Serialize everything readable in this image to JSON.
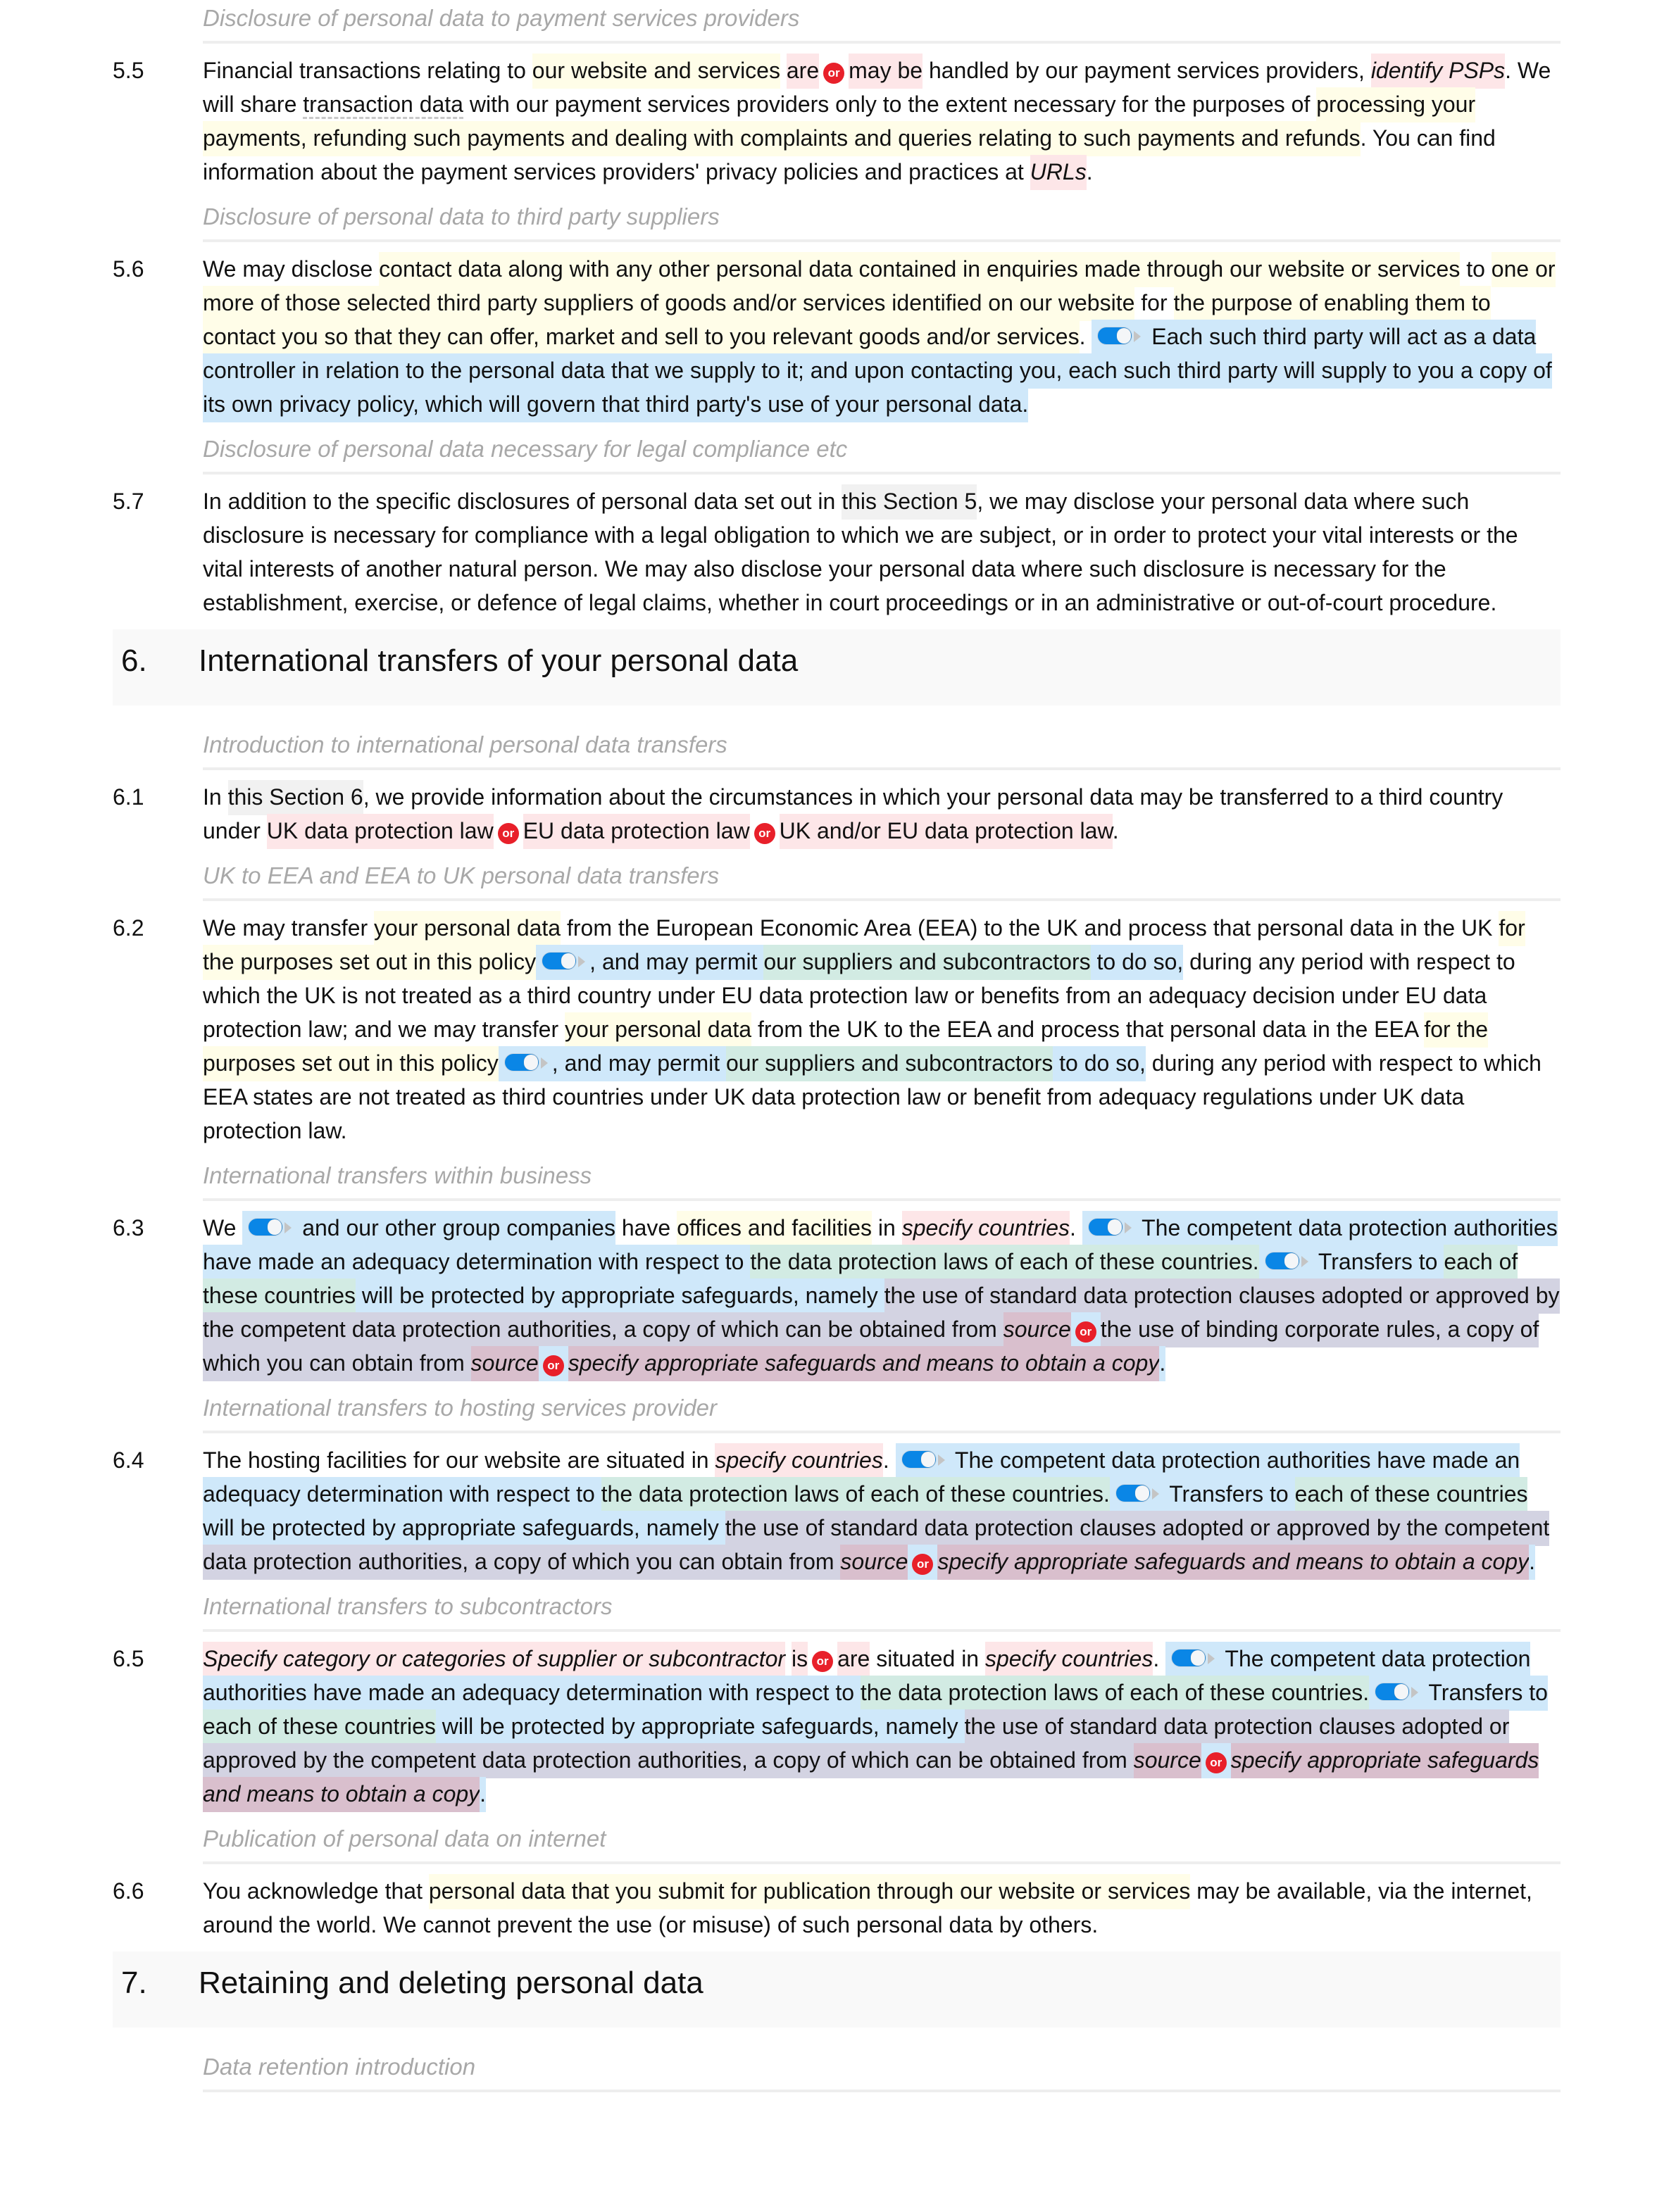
{
  "document": {
    "blocks": [
      {
        "type": "subheading",
        "text": "Disclosure of personal data to payment services providers"
      },
      {
        "type": "clause",
        "number": "5.5",
        "segments": [
          {
            "t": "Financial transactions relating to "
          },
          {
            "t": "our website and services",
            "hl": "y"
          },
          {
            "t": " "
          },
          {
            "t": "are",
            "hl": "p"
          },
          {
            "or": true
          },
          {
            "t": "may be",
            "hl": "p"
          },
          {
            "t": " handled by our payment services providers, "
          },
          {
            "t": "identify PSPs",
            "hl": "p",
            "italic": true
          },
          {
            "t": ". We will share "
          },
          {
            "t": "transaction data",
            "underline": true
          },
          {
            "t": " with our payment services providers only to the extent necessary for the purposes of "
          },
          {
            "t": "processing your payments, refunding such payments and dealing with complaints and queries relating to such payments and refunds",
            "hl": "y"
          },
          {
            "t": ". You can find information about the payment services providers' privacy policies and practices at "
          },
          {
            "t": "URLs",
            "hl": "p",
            "italic": true
          },
          {
            "t": "."
          }
        ]
      },
      {
        "type": "subheading",
        "text": "Disclosure of personal data to third party suppliers"
      },
      {
        "type": "clause",
        "number": "5.6",
        "segments": [
          {
            "t": "We may disclose "
          },
          {
            "t": "contact data",
            "hl": "y",
            "underline": true
          },
          {
            "t": " along with any other personal data contained in enquiries made through our website or services",
            "hl": "y"
          },
          {
            "t": " to "
          },
          {
            "t": "one or more of those selected third party suppliers of goods and/or services identified on our website",
            "hl": "y"
          },
          {
            "t": " for "
          },
          {
            "t": "the purpose of enabling them to contact you so that they can offer, market and sell to you relevant goods and/or services",
            "hl": "y"
          },
          {
            "t": ". "
          },
          {
            "toggle": true,
            "hl": "b"
          },
          {
            "t": " Each such third party will act as a data controller in relation to the personal data that we supply to it; and upon contacting you, each such third party will supply to you a copy of its own privacy policy, which will govern that third party's use of your personal data.",
            "hl": "b"
          }
        ]
      },
      {
        "type": "subheading",
        "text": "Disclosure of personal data necessary for legal compliance etc"
      },
      {
        "type": "clause",
        "number": "5.7",
        "segments": [
          {
            "t": "In addition to the specific disclosures of personal data set out in "
          },
          {
            "t": "this Section 5",
            "hl": "s"
          },
          {
            "t": ", we may disclose your personal data where such disclosure is necessary for compliance with a legal obligation to which we are subject, or in order to protect your vital interests or the vital interests of another natural person. We may also disclose your personal data where such disclosure is necessary for the establishment, exercise, or defence of legal claims, whether in court proceedings or in an administrative or out-of-court procedure."
          }
        ]
      },
      {
        "type": "section",
        "number": "6.",
        "title": "International transfers of your personal data"
      },
      {
        "type": "subheading",
        "text": "Introduction to international personal data transfers"
      },
      {
        "type": "clause",
        "number": "6.1",
        "segments": [
          {
            "t": "In "
          },
          {
            "t": "this Section 6",
            "hl": "s"
          },
          {
            "t": ", we provide information about the circumstances in which your personal data may be transferred to a third country under "
          },
          {
            "t": "UK data protection law",
            "hl": "p"
          },
          {
            "or": true
          },
          {
            "t": "EU data protection law",
            "hl": "p"
          },
          {
            "or": true
          },
          {
            "t": "UK and/or EU data protection law",
            "hl": "p"
          },
          {
            "t": "."
          }
        ]
      },
      {
        "type": "subheading",
        "text": "UK to EEA and EEA to UK personal data transfers"
      },
      {
        "type": "clause",
        "number": "6.2",
        "segments": [
          {
            "t": "We may transfer "
          },
          {
            "t": "your personal data",
            "hl": "y"
          },
          {
            "t": " from the European Economic Area (EEA) to the UK and process that personal data in the UK "
          },
          {
            "t": "for the purposes set out in this policy",
            "hl": "y"
          },
          {
            "toggle": true,
            "hl": "b"
          },
          {
            "t": ", and may permit ",
            "hl": "b"
          },
          {
            "t": "our suppliers and subcontractors",
            "hl": "g"
          },
          {
            "t": " to do so,",
            "hl": "b"
          },
          {
            "t": " during any period with respect to which the UK is not treated as a third country under EU data protection law or benefits from an adequacy decision under EU data protection law; and we may transfer "
          },
          {
            "t": "your personal data",
            "hl": "y"
          },
          {
            "t": " from the UK to the EEA and process that personal data in the EEA "
          },
          {
            "t": "for the purposes set out in this policy",
            "hl": "y"
          },
          {
            "toggle": true,
            "hl": "b"
          },
          {
            "t": ", and may permit ",
            "hl": "b"
          },
          {
            "t": "our suppliers and subcontractors",
            "hl": "g"
          },
          {
            "t": " to do so,",
            "hl": "b"
          },
          {
            "t": " during any period with respect to which EEA states are not treated as third countries under UK data protection law or benefit from adequacy regulations under UK data protection law."
          }
        ]
      },
      {
        "type": "subheading",
        "text": "International transfers within business"
      },
      {
        "type": "clause",
        "number": "6.3",
        "segments": [
          {
            "t": "We "
          },
          {
            "toggle": true,
            "hl": "b"
          },
          {
            "t": " and our other group companies",
            "hl": "b"
          },
          {
            "t": " have "
          },
          {
            "t": "offices and facilities",
            "hl": "y"
          },
          {
            "t": " in "
          },
          {
            "t": "specify countries",
            "hl": "p",
            "italic": true
          },
          {
            "t": ". "
          },
          {
            "toggle": true,
            "hl": "b"
          },
          {
            "t": " The competent data protection authorities have made an adequacy determination with respect to ",
            "hl": "b"
          },
          {
            "t": "the data protection laws of each of these countries.",
            "hl": "g"
          },
          {
            "toggle": true,
            "hl": "b"
          },
          {
            "t": " Transfers to ",
            "hl": "b"
          },
          {
            "t": "each of these countries",
            "hl": "g"
          },
          {
            "t": " will be protected by appropriate safeguards, namely ",
            "hl": "b"
          },
          {
            "t": "the use of standard data protection clauses adopted or approved by the competent data protection authorities, a copy of which can be obtained from ",
            "hl": "v"
          },
          {
            "t": "source",
            "hl": "m",
            "italic": true
          },
          {
            "or": true,
            "hl": "b"
          },
          {
            "t": "the use of binding corporate rules, a copy of which you can obtain from ",
            "hl": "v"
          },
          {
            "t": "source",
            "hl": "m",
            "italic": true
          },
          {
            "or": true,
            "hl": "b"
          },
          {
            "t": "specify appropriate safeguards and means to obtain a copy",
            "hl": "m",
            "italic": true
          },
          {
            "t": ".",
            "hl": "b"
          }
        ]
      },
      {
        "type": "subheading",
        "text": "International transfers to hosting services provider"
      },
      {
        "type": "clause",
        "number": "6.4",
        "segments": [
          {
            "t": "The hosting facilities for our website are situated in "
          },
          {
            "t": "specify countries",
            "hl": "p",
            "italic": true
          },
          {
            "t": ". "
          },
          {
            "toggle": true,
            "hl": "b"
          },
          {
            "t": " The competent data protection authorities have made an adequacy determination with respect to ",
            "hl": "b"
          },
          {
            "t": "the data protection laws of each of these countries.",
            "hl": "g"
          },
          {
            "toggle": true,
            "hl": "b"
          },
          {
            "t": " Transfers to ",
            "hl": "b"
          },
          {
            "t": "each of these countries",
            "hl": "g"
          },
          {
            "t": " will be protected by appropriate safeguards, namely ",
            "hl": "b"
          },
          {
            "t": "the use of standard data protection clauses adopted or approved by the competent data protection authorities, a copy of which you can obtain from ",
            "hl": "v"
          },
          {
            "t": "source",
            "hl": "m",
            "italic": true
          },
          {
            "or": true,
            "hl": "b"
          },
          {
            "t": "specify appropriate safeguards and means to obtain a copy",
            "hl": "m",
            "italic": true
          },
          {
            "t": ".",
            "hl": "b"
          }
        ]
      },
      {
        "type": "subheading",
        "text": "International transfers to subcontractors"
      },
      {
        "type": "clause",
        "number": "6.5",
        "segments": [
          {
            "t": "Specify category or categories of supplier or subcontractor",
            "hl": "p",
            "italic": true
          },
          {
            "t": " "
          },
          {
            "t": "is",
            "hl": "p"
          },
          {
            "or": true
          },
          {
            "t": "are",
            "hl": "p"
          },
          {
            "t": " situated in "
          },
          {
            "t": "specify countries",
            "hl": "p",
            "italic": true
          },
          {
            "t": ". "
          },
          {
            "toggle": true,
            "hl": "b"
          },
          {
            "t": " The competent data protection authorities have made an adequacy determination with respect to ",
            "hl": "b"
          },
          {
            "t": "the data protection laws of each of these countries.",
            "hl": "g"
          },
          {
            "toggle": true,
            "hl": "b"
          },
          {
            "t": " Transfers to ",
            "hl": "b"
          },
          {
            "t": "each of these countries",
            "hl": "g"
          },
          {
            "t": " will be protected by appropriate safeguards, namely ",
            "hl": "b"
          },
          {
            "t": "the use of standard data protection clauses adopted or approved by the competent data protection authorities, a copy of which can be obtained from ",
            "hl": "v"
          },
          {
            "t": "source",
            "hl": "m",
            "italic": true
          },
          {
            "or": true,
            "hl": "b"
          },
          {
            "t": "specify appropriate safeguards and means to obtain a copy",
            "hl": "m",
            "italic": true
          },
          {
            "t": ".",
            "hl": "b"
          }
        ]
      },
      {
        "type": "subheading",
        "text": "Publication of personal data on internet"
      },
      {
        "type": "clause",
        "number": "6.6",
        "segments": [
          {
            "t": "You acknowledge that "
          },
          {
            "t": "personal data that you submit for publication through our website or services",
            "hl": "y"
          },
          {
            "t": " may be available, via the internet, around the world. We cannot prevent the use (or misuse) of such personal data by others."
          }
        ]
      },
      {
        "type": "section",
        "number": "7.",
        "title": "Retaining and deleting personal data"
      },
      {
        "type": "subheading",
        "text": "Data retention introduction"
      }
    ]
  },
  "or_badge_label": "or",
  "icons": {
    "or": "or-badge-icon",
    "toggle": "toggle-switch-icon"
  },
  "colors": {
    "defined_term": "#fffde8",
    "placeholder": "#fde6e8",
    "optional_clause": "#cfe8fa",
    "variable": "#d2ebe3",
    "nested_clause": "#d3d3e2",
    "nested_placeholder": "#d9bfcd",
    "or_badge": "#e8202a",
    "toggle": "#0a86e6"
  }
}
